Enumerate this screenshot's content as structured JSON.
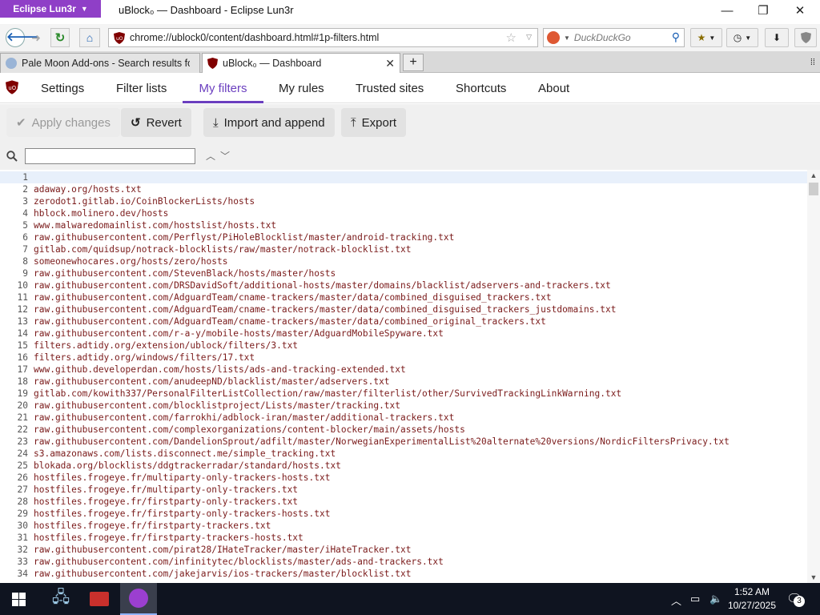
{
  "window": {
    "app_menu": "Eclipse Lun3r",
    "title": "uBlock₀ — Dashboard - Eclipse Lun3r"
  },
  "navbar": {
    "url": "chrome://ublock0/content/dashboard.html#1p-filters.html",
    "search_placeholder": "DuckDuckGo"
  },
  "tabs": [
    {
      "label": "Pale Moon Add-ons - Search results fo"
    },
    {
      "label": "uBlock₀ — Dashboard"
    }
  ],
  "dashboard": {
    "tabs": [
      "Settings",
      "Filter lists",
      "My filters",
      "My rules",
      "Trusted sites",
      "Shortcuts",
      "About"
    ],
    "active_tab": "My filters"
  },
  "actions": {
    "apply": "Apply changes",
    "revert": "Revert",
    "import": "Import and append",
    "export": "Export"
  },
  "editor": {
    "lines": [
      "",
      "adaway.org/hosts.txt",
      "zerodot1.gitlab.io/CoinBlockerLists/hosts",
      "hblock.molinero.dev/hosts",
      "www.malwaredomainlist.com/hostslist/hosts.txt",
      "raw.githubusercontent.com/Perflyst/PiHoleBlocklist/master/android-tracking.txt",
      "gitlab.com/quidsup/notrack-blocklists/raw/master/notrack-blocklist.txt",
      "someonewhocares.org/hosts/zero/hosts",
      "raw.githubusercontent.com/StevenBlack/hosts/master/hosts",
      "raw.githubusercontent.com/DRSDavidSoft/additional-hosts/master/domains/blacklist/adservers-and-trackers.txt",
      "raw.githubusercontent.com/AdguardTeam/cname-trackers/master/data/combined_disguised_trackers.txt",
      "raw.githubusercontent.com/AdguardTeam/cname-trackers/master/data/combined_disguised_trackers_justdomains.txt",
      "raw.githubusercontent.com/AdguardTeam/cname-trackers/master/data/combined_original_trackers.txt",
      "raw.githubusercontent.com/r-a-y/mobile-hosts/master/AdguardMobileSpyware.txt",
      "filters.adtidy.org/extension/ublock/filters/3.txt",
      "filters.adtidy.org/windows/filters/17.txt",
      "www.github.developerdan.com/hosts/lists/ads-and-tracking-extended.txt",
      "raw.githubusercontent.com/anudeepND/blacklist/master/adservers.txt",
      "gitlab.com/kowith337/PersonalFilterListCollection/raw/master/filterlist/other/SurvivedTrackingLinkWarning.txt",
      "raw.githubusercontent.com/blocklistproject/Lists/master/tracking.txt",
      "raw.githubusercontent.com/farrokhi/adblock-iran/master/additional-trackers.txt",
      "raw.githubusercontent.com/complexorganizations/content-blocker/main/assets/hosts",
      "raw.githubusercontent.com/DandelionSprout/adfilt/master/NorwegianExperimentalList%20alternate%20versions/NordicFiltersPrivacy.txt",
      "s3.amazonaws.com/lists.disconnect.me/simple_tracking.txt",
      "blokada.org/blocklists/ddgtrackerradar/standard/hosts.txt",
      "hostfiles.frogeye.fr/multiparty-only-trackers-hosts.txt",
      "hostfiles.frogeye.fr/multiparty-only-trackers.txt",
      "hostfiles.frogeye.fr/firstparty-only-trackers.txt",
      "hostfiles.frogeye.fr/firstparty-only-trackers-hosts.txt",
      "hostfiles.frogeye.fr/firstparty-trackers.txt",
      "hostfiles.frogeye.fr/firstparty-trackers-hosts.txt",
      "raw.githubusercontent.com/pirat28/IHateTracker/master/iHateTracker.txt",
      "raw.githubusercontent.com/infinitytec/blocklists/master/ads-and-trackers.txt",
      "raw.githubusercontent.com/jakejarvis/ios-trackers/master/blocklist.txt"
    ]
  },
  "taskbar": {
    "time": "1:52 AM",
    "date": "10/27/2025",
    "notification_count": "3"
  },
  "colors": {
    "accent": "#6b3fbf",
    "app_menu": "#8f3fc7",
    "filter_text": "#7a1a1a"
  }
}
